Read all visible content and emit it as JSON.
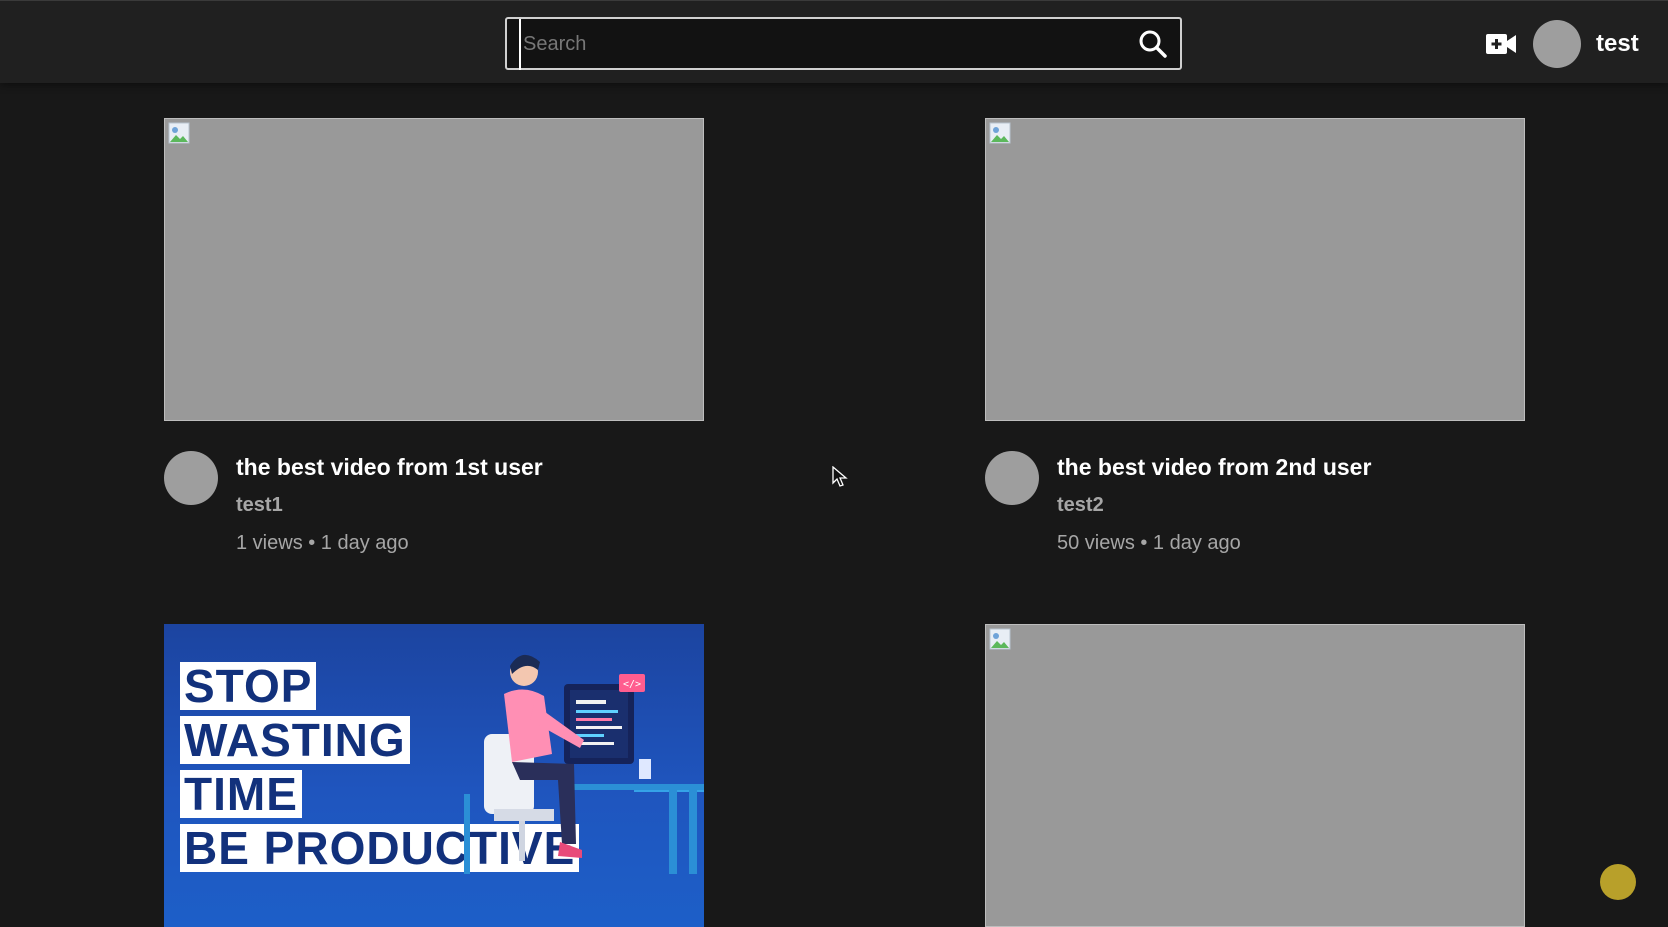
{
  "header": {
    "search_placeholder": "Search",
    "username": "test"
  },
  "videos": [
    {
      "title": "the best video from 1st user",
      "channel": "test1",
      "views": "1 views",
      "age": "1 day ago",
      "stats": "1 views • 1 day ago"
    },
    {
      "title": "the best video from 2nd user",
      "channel": "test2",
      "views": "50 views",
      "age": "1 day ago",
      "stats": "50 views • 1 day ago"
    },
    {
      "thumbnail_text": [
        "STOP",
        "WASTING",
        "TIME",
        "BE PRODUCTIVE"
      ]
    },
    {}
  ],
  "icons": {
    "search": "search-icon",
    "create_video": "video-camera-plus-icon",
    "broken_image": "broken-image-icon"
  },
  "colors": {
    "background": "#181818",
    "topbar": "#202020",
    "placeholder_thumb": "#999999",
    "avatar": "#9e9e9e",
    "muted_text": "#a6a6a6",
    "promo_blue": "#1f55be"
  }
}
